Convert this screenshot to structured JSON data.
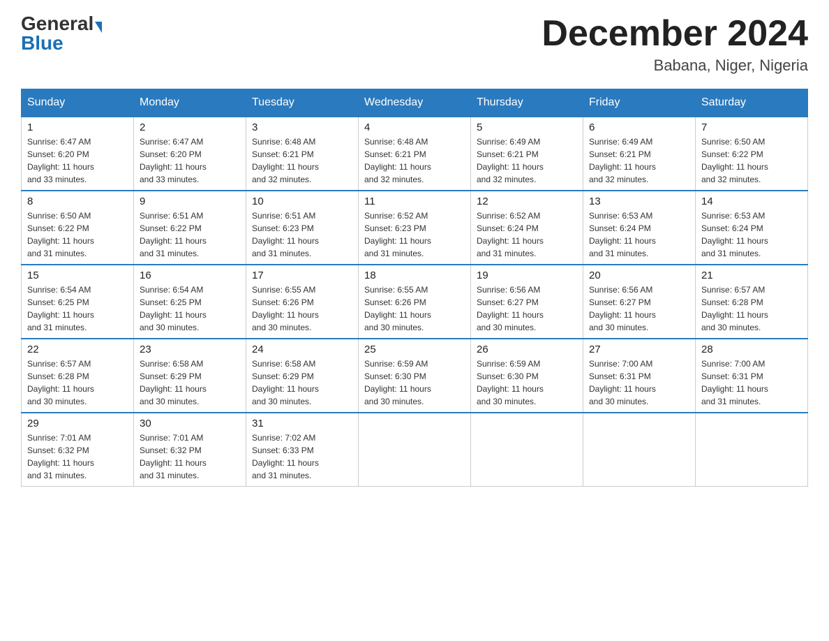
{
  "header": {
    "logo_general": "General",
    "logo_blue": "Blue",
    "month_title": "December 2024",
    "location": "Babana, Niger, Nigeria"
  },
  "days_of_week": [
    "Sunday",
    "Monday",
    "Tuesday",
    "Wednesday",
    "Thursday",
    "Friday",
    "Saturday"
  ],
  "weeks": [
    [
      {
        "day": "1",
        "sunrise": "6:47 AM",
        "sunset": "6:20 PM",
        "daylight": "11 hours and 33 minutes."
      },
      {
        "day": "2",
        "sunrise": "6:47 AM",
        "sunset": "6:20 PM",
        "daylight": "11 hours and 33 minutes."
      },
      {
        "day": "3",
        "sunrise": "6:48 AM",
        "sunset": "6:21 PM",
        "daylight": "11 hours and 32 minutes."
      },
      {
        "day": "4",
        "sunrise": "6:48 AM",
        "sunset": "6:21 PM",
        "daylight": "11 hours and 32 minutes."
      },
      {
        "day": "5",
        "sunrise": "6:49 AM",
        "sunset": "6:21 PM",
        "daylight": "11 hours and 32 minutes."
      },
      {
        "day": "6",
        "sunrise": "6:49 AM",
        "sunset": "6:21 PM",
        "daylight": "11 hours and 32 minutes."
      },
      {
        "day": "7",
        "sunrise": "6:50 AM",
        "sunset": "6:22 PM",
        "daylight": "11 hours and 32 minutes."
      }
    ],
    [
      {
        "day": "8",
        "sunrise": "6:50 AM",
        "sunset": "6:22 PM",
        "daylight": "11 hours and 31 minutes."
      },
      {
        "day": "9",
        "sunrise": "6:51 AM",
        "sunset": "6:22 PM",
        "daylight": "11 hours and 31 minutes."
      },
      {
        "day": "10",
        "sunrise": "6:51 AM",
        "sunset": "6:23 PM",
        "daylight": "11 hours and 31 minutes."
      },
      {
        "day": "11",
        "sunrise": "6:52 AM",
        "sunset": "6:23 PM",
        "daylight": "11 hours and 31 minutes."
      },
      {
        "day": "12",
        "sunrise": "6:52 AM",
        "sunset": "6:24 PM",
        "daylight": "11 hours and 31 minutes."
      },
      {
        "day": "13",
        "sunrise": "6:53 AM",
        "sunset": "6:24 PM",
        "daylight": "11 hours and 31 minutes."
      },
      {
        "day": "14",
        "sunrise": "6:53 AM",
        "sunset": "6:24 PM",
        "daylight": "11 hours and 31 minutes."
      }
    ],
    [
      {
        "day": "15",
        "sunrise": "6:54 AM",
        "sunset": "6:25 PM",
        "daylight": "11 hours and 31 minutes."
      },
      {
        "day": "16",
        "sunrise": "6:54 AM",
        "sunset": "6:25 PM",
        "daylight": "11 hours and 30 minutes."
      },
      {
        "day": "17",
        "sunrise": "6:55 AM",
        "sunset": "6:26 PM",
        "daylight": "11 hours and 30 minutes."
      },
      {
        "day": "18",
        "sunrise": "6:55 AM",
        "sunset": "6:26 PM",
        "daylight": "11 hours and 30 minutes."
      },
      {
        "day": "19",
        "sunrise": "6:56 AM",
        "sunset": "6:27 PM",
        "daylight": "11 hours and 30 minutes."
      },
      {
        "day": "20",
        "sunrise": "6:56 AM",
        "sunset": "6:27 PM",
        "daylight": "11 hours and 30 minutes."
      },
      {
        "day": "21",
        "sunrise": "6:57 AM",
        "sunset": "6:28 PM",
        "daylight": "11 hours and 30 minutes."
      }
    ],
    [
      {
        "day": "22",
        "sunrise": "6:57 AM",
        "sunset": "6:28 PM",
        "daylight": "11 hours and 30 minutes."
      },
      {
        "day": "23",
        "sunrise": "6:58 AM",
        "sunset": "6:29 PM",
        "daylight": "11 hours and 30 minutes."
      },
      {
        "day": "24",
        "sunrise": "6:58 AM",
        "sunset": "6:29 PM",
        "daylight": "11 hours and 30 minutes."
      },
      {
        "day": "25",
        "sunrise": "6:59 AM",
        "sunset": "6:30 PM",
        "daylight": "11 hours and 30 minutes."
      },
      {
        "day": "26",
        "sunrise": "6:59 AM",
        "sunset": "6:30 PM",
        "daylight": "11 hours and 30 minutes."
      },
      {
        "day": "27",
        "sunrise": "7:00 AM",
        "sunset": "6:31 PM",
        "daylight": "11 hours and 30 minutes."
      },
      {
        "day": "28",
        "sunrise": "7:00 AM",
        "sunset": "6:31 PM",
        "daylight": "11 hours and 31 minutes."
      }
    ],
    [
      {
        "day": "29",
        "sunrise": "7:01 AM",
        "sunset": "6:32 PM",
        "daylight": "11 hours and 31 minutes."
      },
      {
        "day": "30",
        "sunrise": "7:01 AM",
        "sunset": "6:32 PM",
        "daylight": "11 hours and 31 minutes."
      },
      {
        "day": "31",
        "sunrise": "7:02 AM",
        "sunset": "6:33 PM",
        "daylight": "11 hours and 31 minutes."
      },
      null,
      null,
      null,
      null
    ]
  ],
  "labels": {
    "sunrise": "Sunrise:",
    "sunset": "Sunset:",
    "daylight": "Daylight:"
  }
}
